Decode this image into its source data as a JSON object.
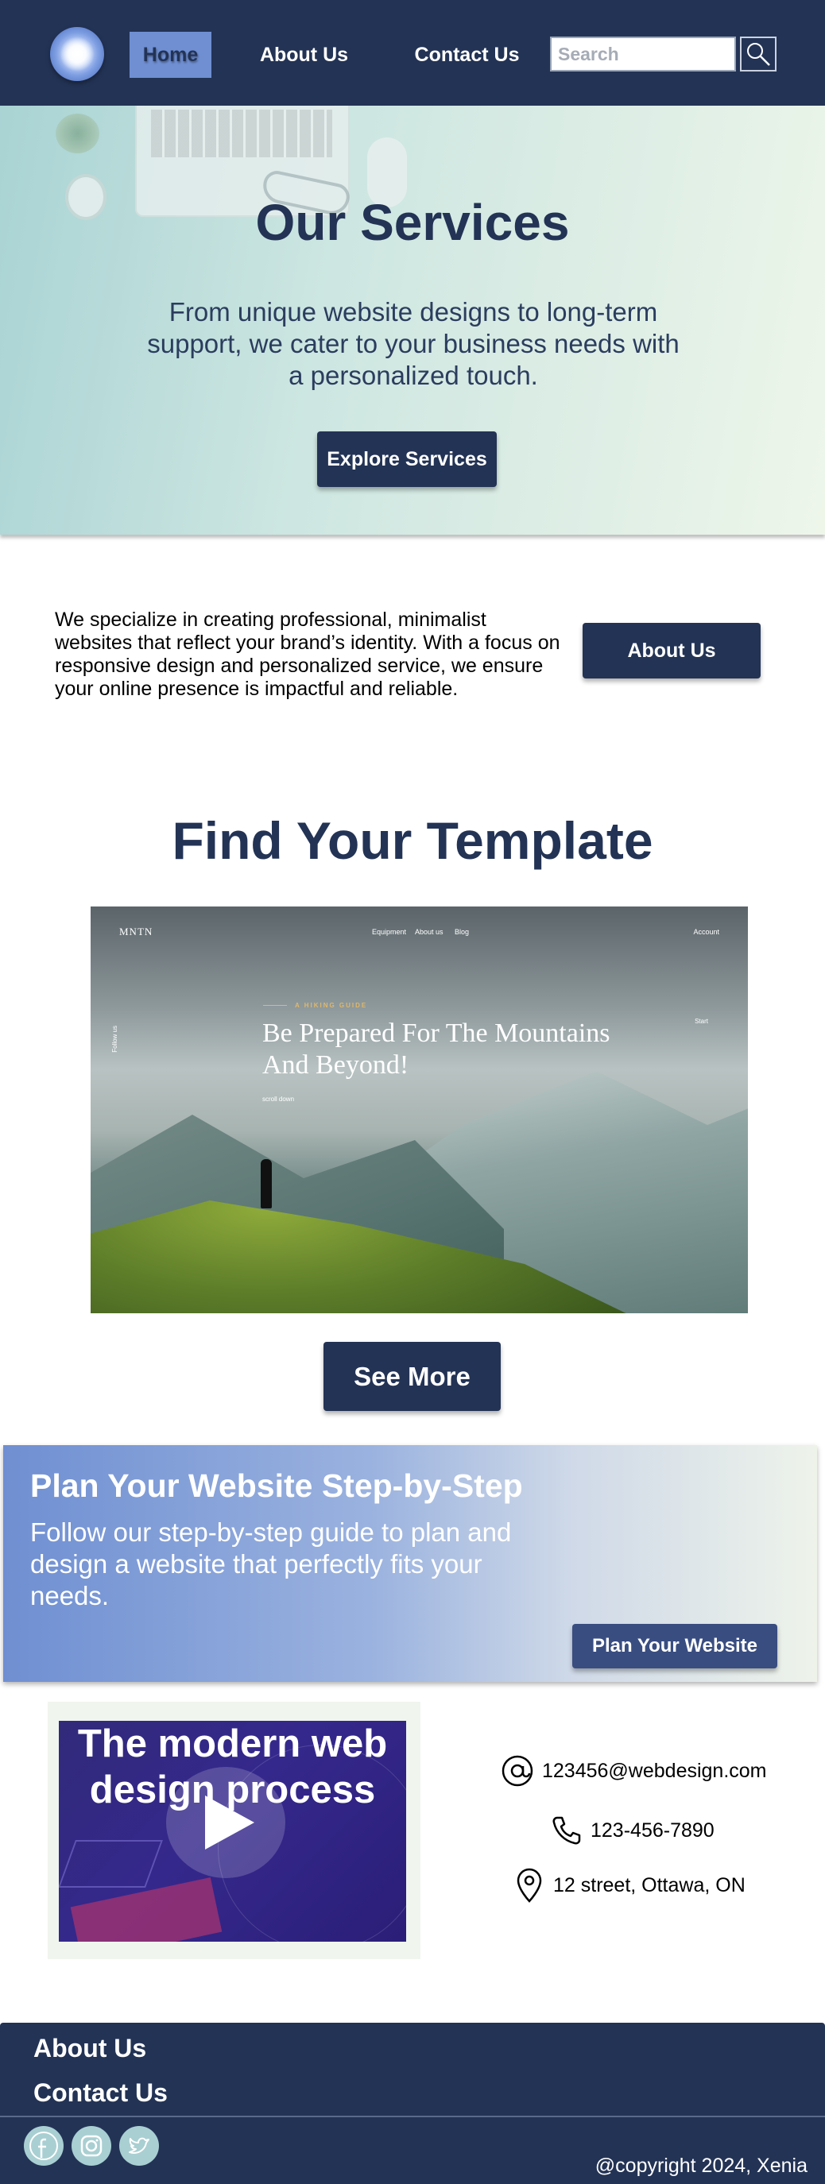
{
  "nav": {
    "items": [
      {
        "label": "Home",
        "active": true
      },
      {
        "label": "About Us"
      },
      {
        "label": "Contact Us"
      }
    ],
    "search_placeholder": "Search",
    "icons": {
      "logo": "sparkle-logo-icon",
      "search": "search-icon"
    }
  },
  "hero": {
    "title": "Our Services",
    "subtitle": "From unique website designs to long-term support, we cater to your business needs with a personalized touch.",
    "button": "Explore Services"
  },
  "about": {
    "text": "We specialize in creating professional, minimalist websites that reflect your brand’s identity. With a focus on responsive design and personalized service, we ensure your online presence is impactful and reliable.",
    "button": "About Us"
  },
  "templates": {
    "title": "Find Your Template",
    "preview": {
      "brand": "MNTN",
      "nav": [
        "Equipment",
        "About us",
        "Blog"
      ],
      "account": "Account",
      "kicker": "A HIKING GUIDE",
      "headline": "Be Prepared For The Mountains And Beyond!",
      "scroll": "scroll down",
      "follow": "Follow us",
      "start": "Start"
    },
    "button": "See More"
  },
  "plan": {
    "title": "Plan Your Website Step-by-Step",
    "text": "Follow our step-by-step guide to plan and design a website that perfectly fits your needs.",
    "button": "Plan Your Website"
  },
  "video": {
    "title": "The modern web design process",
    "icon": "play-icon"
  },
  "contact": {
    "email": "123456@webdesign.com",
    "phone": "123-456-7890",
    "address": "12 street, Ottawa, ON",
    "icons": {
      "email": "at-sign-icon",
      "phone": "phone-icon",
      "address": "map-pin-icon"
    }
  },
  "footer": {
    "links": [
      "About Us",
      "Contact Us"
    ],
    "social_icons": [
      "facebook-icon",
      "instagram-icon",
      "twitter-icon"
    ],
    "copyright": "@copyright 2024, Xenia"
  },
  "colors": {
    "navy": "#233355",
    "accent_blue": "#6f8fd2",
    "hero_teal": "#a9d3d4",
    "social_bg": "#a9cfd2"
  }
}
